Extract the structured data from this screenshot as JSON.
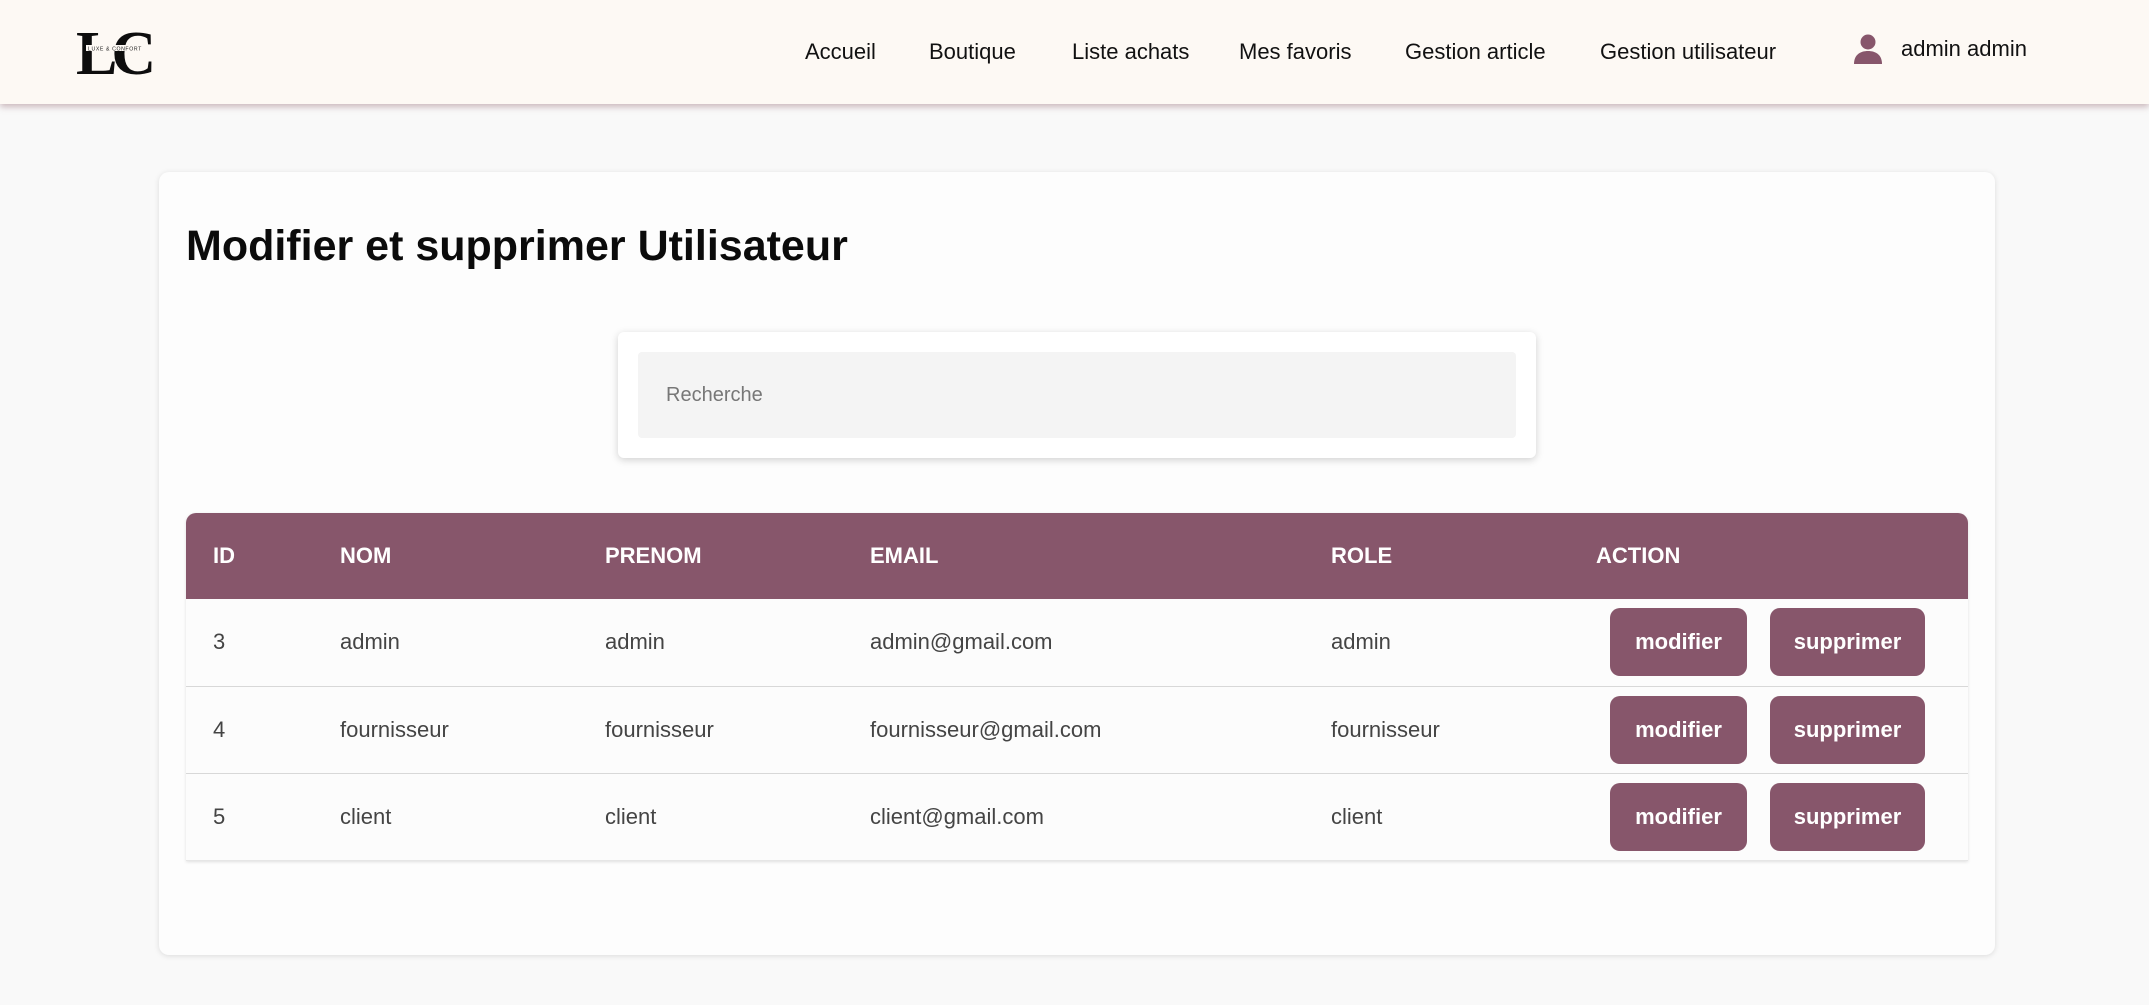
{
  "header": {
    "logo": {
      "monogram": "LC",
      "tagline": "LUXE & CONFORT"
    },
    "nav": [
      {
        "label": "Accueil"
      },
      {
        "label": "Boutique"
      },
      {
        "label": "Liste achats"
      },
      {
        "label": "Mes favoris"
      },
      {
        "label": "Gestion article"
      },
      {
        "label": "Gestion utilisateur"
      }
    ],
    "user": {
      "icon": "user-icon",
      "name": "admin admin"
    }
  },
  "page": {
    "title": "Modifier et supprimer Utilisateur"
  },
  "search": {
    "placeholder": "Recherche",
    "value": ""
  },
  "table": {
    "columns": [
      "ID",
      "NOM",
      "PRENOM",
      "EMAIL",
      "ROLE",
      "ACTION"
    ],
    "rows": [
      {
        "id": "3",
        "nom": "admin",
        "prenom": "admin",
        "email": "admin@gmail.com",
        "role": "admin"
      },
      {
        "id": "4",
        "nom": "fournisseur",
        "prenom": "fournisseur",
        "email": "fournisseur@gmail.com",
        "role": "fournisseur"
      },
      {
        "id": "5",
        "nom": "client",
        "prenom": "client",
        "email": "client@gmail.com",
        "role": "client"
      }
    ],
    "actions": {
      "edit_label": "modifier",
      "delete_label": "supprimer"
    }
  },
  "colors": {
    "accent": "#87566b",
    "header_bg": "#fdf9f4",
    "page_bg": "#f9f9f9"
  }
}
